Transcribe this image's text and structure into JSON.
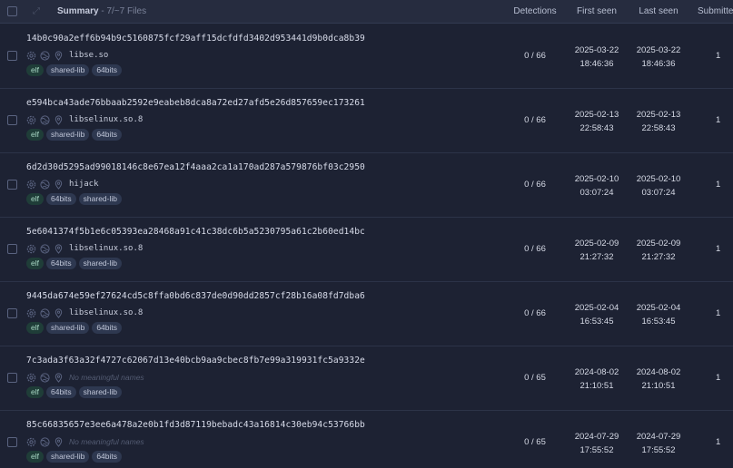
{
  "header": {
    "summary_label": "Summary",
    "file_count": " - 7/~7 Files",
    "detections_label": "Detections",
    "first_seen_label": "First seen",
    "last_seen_label": "Last seen",
    "submitters_label": "Submitte"
  },
  "rows": [
    {
      "hash": "14b0c90a2eff6b94b9c5160875fcf29aff15dcfdfd3402d953441d9b0dca8b39",
      "name": "libse.so",
      "tags": [
        "elf",
        "shared-lib",
        "64bits"
      ],
      "detections": "0 / 66",
      "first_date": "2025-03-22",
      "first_time": "18:46:36",
      "last_date": "2025-03-22",
      "last_time": "18:46:36",
      "submitters": "1"
    },
    {
      "hash": "e594bca43ade76bbaab2592e9eabeb8dca8a72ed27afd5e26d857659ec173261",
      "name": "libselinux.so.8",
      "tags": [
        "elf",
        "shared-lib",
        "64bits"
      ],
      "detections": "0 / 66",
      "first_date": "2025-02-13",
      "first_time": "22:58:43",
      "last_date": "2025-02-13",
      "last_time": "22:58:43",
      "submitters": "1"
    },
    {
      "hash": "6d2d30d5295ad99018146c8e67ea12f4aaa2ca1a170ad287a579876bf03c2950",
      "name": "hijack",
      "tags": [
        "elf",
        "64bits",
        "shared-lib"
      ],
      "detections": "0 / 66",
      "first_date": "2025-02-10",
      "first_time": "03:07:24",
      "last_date": "2025-02-10",
      "last_time": "03:07:24",
      "submitters": "1"
    },
    {
      "hash": "5e6041374f5b1e6c05393ea28468a91c41c38dc6b5a5230795a61c2b60ed14bc",
      "name": "libselinux.so.8",
      "tags": [
        "elf",
        "64bits",
        "shared-lib"
      ],
      "detections": "0 / 66",
      "first_date": "2025-02-09",
      "first_time": "21:27:32",
      "last_date": "2025-02-09",
      "last_time": "21:27:32",
      "submitters": "1"
    },
    {
      "hash": "9445da674e59ef27624cd5c8ffa0bd6c837de0d90dd2857cf28b16a08fd7dba6",
      "name": "libselinux.so.8",
      "tags": [
        "elf",
        "shared-lib",
        "64bits"
      ],
      "detections": "0 / 66",
      "first_date": "2025-02-04",
      "first_time": "16:53:45",
      "last_date": "2025-02-04",
      "last_time": "16:53:45",
      "submitters": "1"
    },
    {
      "hash": "7c3ada3f63a32f4727c62067d13e40bcb9aa9cbec8fb7e99a319931fc5a9332e",
      "name": "No meaningful names",
      "name_empty": true,
      "tags": [
        "elf",
        "64bits",
        "shared-lib"
      ],
      "detections": "0 / 65",
      "first_date": "2024-08-02",
      "first_time": "21:10:51",
      "last_date": "2024-08-02",
      "last_time": "21:10:51",
      "submitters": "1"
    },
    {
      "hash": "85c66835657e3ee6a478a2e0b1fd3d87119bebadc43a16814c30eb94c53766bb",
      "name": "No meaningful names",
      "name_empty": true,
      "tags": [
        "elf",
        "shared-lib",
        "64bits"
      ],
      "detections": "0 / 65",
      "first_date": "2024-07-29",
      "first_time": "17:55:52",
      "last_date": "2024-07-29",
      "last_time": "17:55:52",
      "submitters": "1"
    }
  ],
  "icons": [
    "settings-icon",
    "globe-icon",
    "location-pin-icon"
  ],
  "colors": {
    "background": "#1d2233",
    "header": "#262c3f",
    "tag": "#2e3850",
    "elf_tag": "#1f3d38"
  }
}
